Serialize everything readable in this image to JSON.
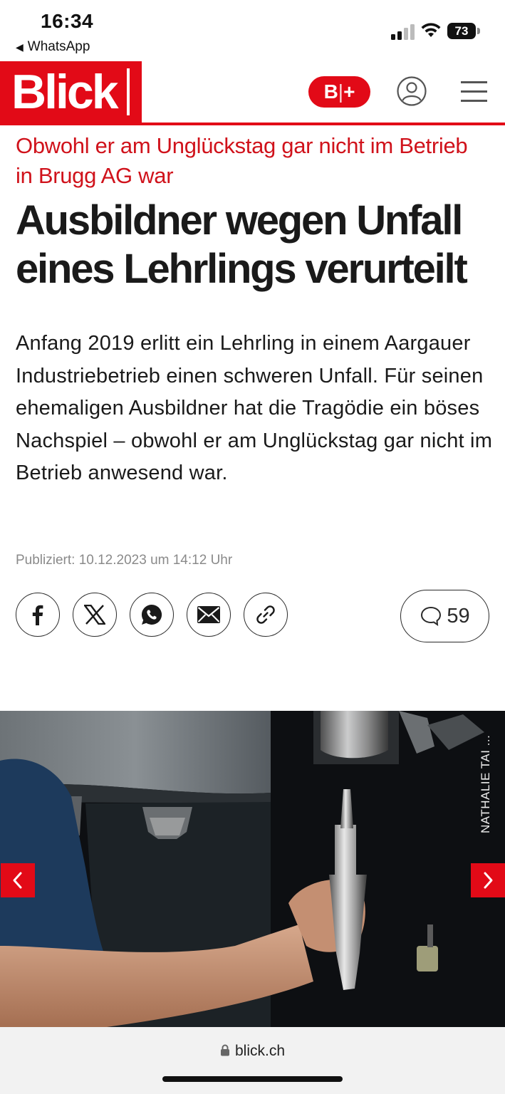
{
  "status_bar": {
    "time": "16:34",
    "back_app": "WhatsApp",
    "battery": "73"
  },
  "header": {
    "logo": "Blick",
    "plus_badge": "B",
    "plus_sign": "+",
    "accent_color": "#e20a17"
  },
  "article": {
    "kicker": "Obwohl er am Unglückstag gar nicht im Betrieb in Brugg AG war",
    "title": "Ausbildner wegen Unfall eines Lehrlings verurteilt",
    "lead": "Anfang 2019 erlitt ein Lehrling in einem Aargauer Industriebetrieb einen schweren Unfall. Für seinen ehemaligen Ausbildner hat die Tragödie ein böses Nachspiel – obwohl er am Unglückstag gar nicht im Betrieb anwesend war.",
    "published": "Publiziert: 10.12.2023 um 14:12 Uhr"
  },
  "share": {
    "icons": [
      "facebook-icon",
      "x-icon",
      "whatsapp-icon",
      "mail-icon",
      "link-icon"
    ],
    "comment_count": "59"
  },
  "hero": {
    "credit": "NATHALIE TAI ..."
  },
  "browser": {
    "url": "blick.ch"
  }
}
